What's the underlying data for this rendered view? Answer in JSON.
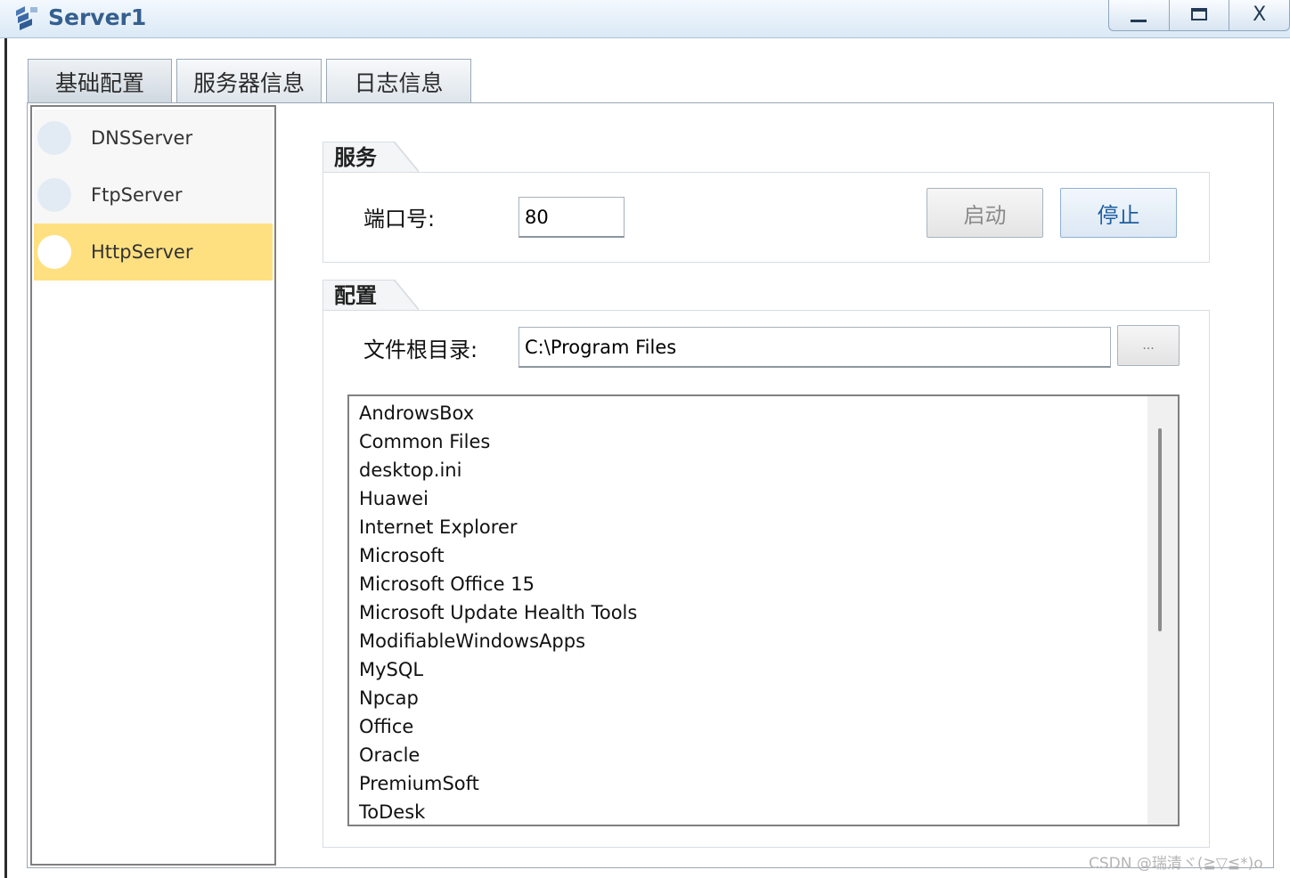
{
  "window": {
    "title": "Server1",
    "icon": "server-app-icon",
    "controls": {
      "minimize": "minimize",
      "maximize": "maximize",
      "close": "X"
    }
  },
  "tabs": [
    {
      "label": "基础配置",
      "active": true
    },
    {
      "label": "服务器信息",
      "active": false
    },
    {
      "label": "日志信息",
      "active": false
    }
  ],
  "servers": [
    {
      "label": "DNSServer",
      "selected": false
    },
    {
      "label": "FtpServer",
      "selected": false
    },
    {
      "label": "HttpServer",
      "selected": true
    }
  ],
  "service_group": {
    "title": "服务",
    "port_label": "端口号:",
    "port_value": "80",
    "start_label": "启动",
    "stop_label": "停止"
  },
  "config_group": {
    "title": "配置",
    "root_label": "文件根目录:",
    "root_value": "C:\\Program Files",
    "browse_label": "...",
    "files": [
      "AndrowsBox",
      "Common Files",
      "desktop.ini",
      "Huawei",
      "Internet Explorer",
      "Microsoft",
      "Microsoft Office 15",
      "Microsoft Update Health Tools",
      "ModifiableWindowsApps",
      "MySQL",
      "Npcap",
      "Office",
      "Oracle",
      "PremiumSoft",
      "ToDesk"
    ]
  },
  "watermark": "CSDN @瑞清ヾ(≧▽≦*)o",
  "colors": {
    "selected_item": "#ffe081",
    "title_text": "#355f8f",
    "stop_button_text": "#1f5e9e"
  }
}
